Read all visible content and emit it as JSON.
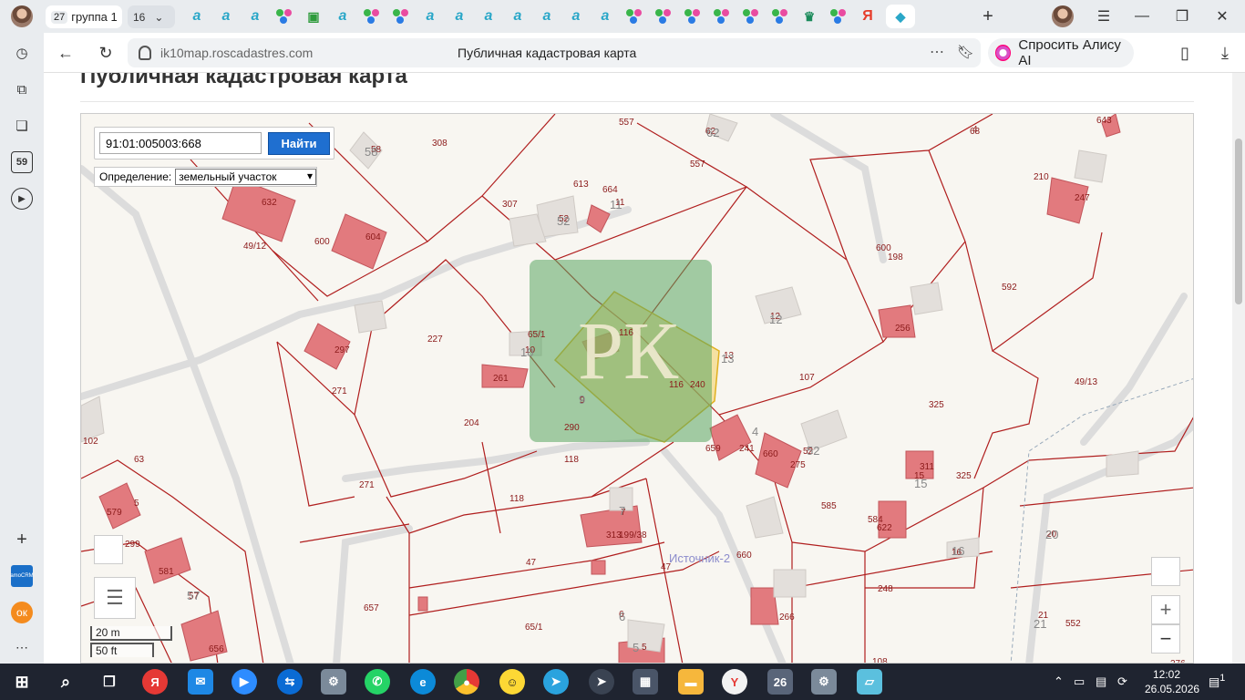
{
  "tabbar": {
    "group_count": "27",
    "group_label": "группа 1",
    "second_group_count": "16",
    "icons": [
      "a",
      "a",
      "a",
      "dots",
      "green",
      "a",
      "dots",
      "dots",
      "a",
      "a",
      "a",
      "a",
      "a",
      "a",
      "a",
      "dots",
      "dots",
      "dots",
      "dots",
      "dots",
      "dots",
      "green",
      "dots",
      "ya",
      "active"
    ]
  },
  "navbar": {
    "host": "ik10map.roscadastres.com",
    "page_title": "Публичная кадастровая карта",
    "alice_label": "Спросить Алису AI"
  },
  "sidebar": {
    "badge": "59"
  },
  "page": {
    "title": "Публичная кадастровая карта"
  },
  "map": {
    "search_value": "91:01:005003:668",
    "search_button": "Найти",
    "definition_label": "Определение:",
    "definition_value": "земельный участок",
    "scale_m": "20 m",
    "scale_ft": "50 ft",
    "zoom_in": "+",
    "zoom_out": "−",
    "watermark": "РК",
    "stream_label": "Источник-2",
    "parcel_labels": [
      "557",
      "62",
      "308",
      "58",
      "557",
      "613",
      "664",
      "11",
      "307",
      "52",
      "632",
      "604",
      "600",
      "49/12",
      "65/1",
      "12",
      "198",
      "592",
      "256",
      "210",
      "247",
      "227",
      "297",
      "10",
      "116",
      "13",
      "107",
      "271",
      "261",
      "116",
      "240",
      "325",
      "49/13",
      "204",
      "290",
      "9",
      "118",
      "659",
      "241",
      "660",
      "52",
      "275",
      "311",
      "325",
      "102",
      "63",
      "271",
      "118",
      "7",
      "585",
      "584",
      "15",
      "579",
      "5",
      "299",
      "313",
      "199/38",
      "16",
      "20",
      "581",
      "47",
      "57",
      "47",
      "660",
      "248",
      "21",
      "657",
      "65/1",
      "6",
      "552",
      "656",
      "266",
      "108",
      "622",
      "600",
      "68",
      "643",
      "4",
      "276",
      "5"
    ],
    "quarter_labels": [
      "58",
      "52",
      "11",
      "12",
      "10",
      "13",
      "9",
      "4",
      "52",
      "15",
      "16",
      "20",
      "21",
      "57",
      "7",
      "6",
      "5",
      "62"
    ]
  },
  "taskbar": {
    "time": "12:02",
    "date": "26.05.2026",
    "notifications": "1"
  }
}
